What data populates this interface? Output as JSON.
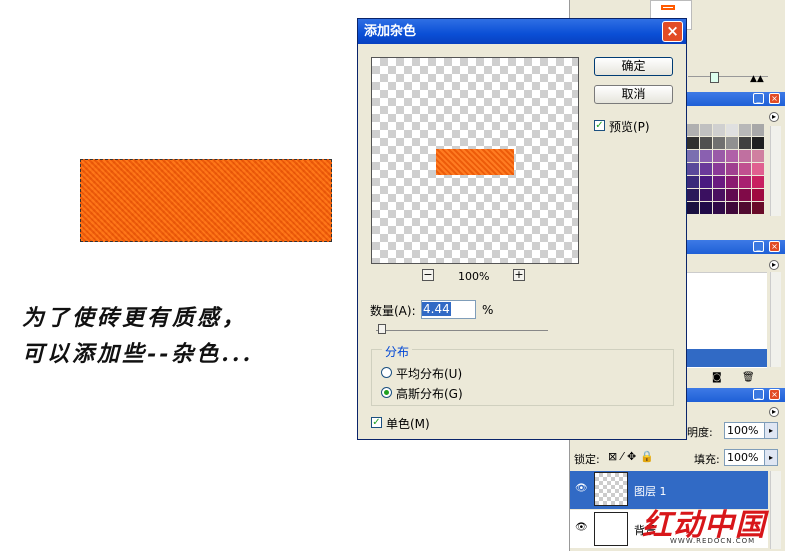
{
  "canvas": {
    "note_line1": "为了使砖更有质感，",
    "note_line2": "可以添加些--杂色..."
  },
  "dialog": {
    "title": "添加杂色",
    "close_glyph": "×",
    "ok_label": "确定",
    "cancel_label": "取消",
    "preview_label": "预览(P)",
    "preview_checked": true,
    "zoom_out_glyph": "−",
    "zoom_in_glyph": "+",
    "zoom_level": "100%",
    "amount_label": "数量(A):",
    "amount_value": "4.44",
    "amount_unit": "%",
    "distribution_title": "分布",
    "uniform_label": "平均分布(U)",
    "gaussian_label": "高斯分布(G)",
    "selected_distribution": "gaussian",
    "monochrome_label": "单色(M)",
    "monochrome_checked": true
  },
  "layers_panel": {
    "opacity_label": "不透明度:",
    "opacity_value": "100%",
    "lock_label": "锁定:",
    "fill_label": "填充:",
    "fill_value": "100%",
    "layers": [
      {
        "name": "图层 1",
        "selected": true
      },
      {
        "name": "背景",
        "selected": false
      }
    ]
  },
  "watermark": {
    "logo_text": "红动中国",
    "url_text": "WWW.REDOCN.COM"
  },
  "colors": {
    "brick": "#ff6a10",
    "title_blue": "#0a4fd6",
    "dialog_bg": "#ece9d8"
  }
}
